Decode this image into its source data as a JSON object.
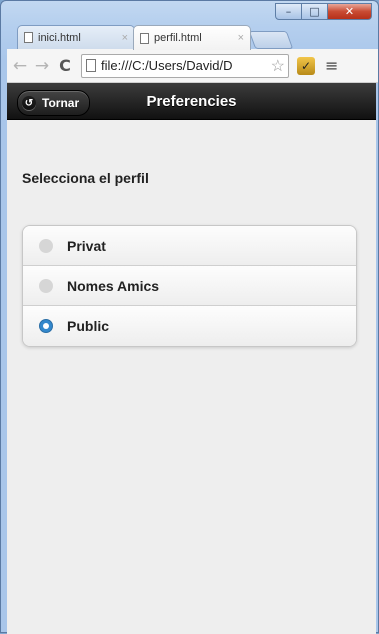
{
  "browser": {
    "tabs": [
      {
        "label": "inici.html",
        "close": "×"
      },
      {
        "label": "perfil.html",
        "close": "×"
      }
    ],
    "window_controls": {
      "minimize": "–",
      "maximize": "□",
      "close": "✕"
    },
    "nav": {
      "back": "←",
      "forward": "→",
      "reload": "C"
    },
    "address": "file:///C:/Users/David/D",
    "star": "☆",
    "extension": "✓",
    "menu": "≡"
  },
  "header": {
    "title": "Preferencies",
    "back_label": "Tornar",
    "back_icon": "↺"
  },
  "form": {
    "legend": "Selecciona el perfil",
    "options": [
      {
        "label": "Privat",
        "checked": false
      },
      {
        "label": "Nomes Amics",
        "checked": false
      },
      {
        "label": "Public",
        "checked": true
      }
    ]
  },
  "colors": {
    "accent": "#3388cc",
    "header_bg": "#1d1d1d",
    "page_bg": "#eeeeee"
  }
}
